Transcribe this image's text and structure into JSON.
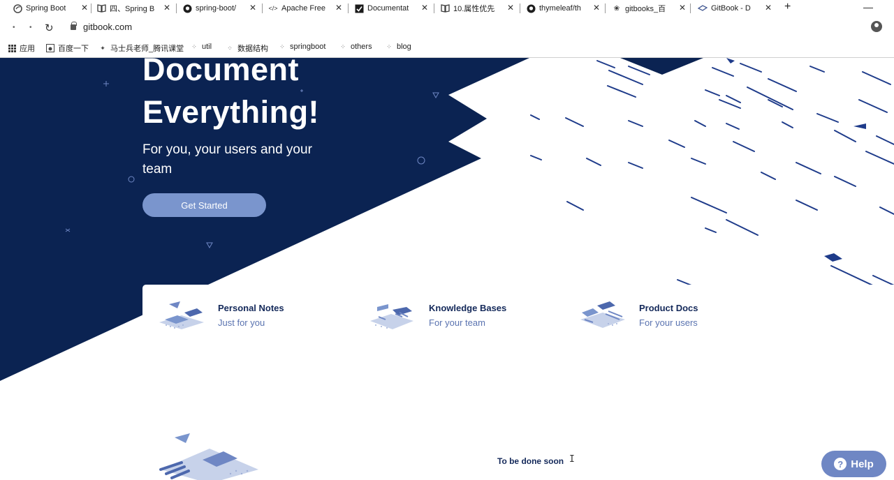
{
  "browser": {
    "tabs": [
      {
        "title": "Spring Boot",
        "icon": "spring-icon"
      },
      {
        "title": "四、Spring B",
        "icon": "book-icon"
      },
      {
        "title": "spring-boot/",
        "icon": "github-icon"
      },
      {
        "title": "Apache Free",
        "icon": "code-icon"
      },
      {
        "title": "Documentat",
        "icon": "doc-icon"
      },
      {
        "title": "10.属性优先",
        "icon": "book-icon"
      },
      {
        "title": "thymeleaf/th",
        "icon": "github-icon"
      },
      {
        "title": "gitbooks_百",
        "icon": "paw-icon"
      },
      {
        "title": "GitBook - D",
        "icon": "gitbook-icon"
      }
    ],
    "url": "gitbook.com",
    "bookmarks": [
      {
        "label": "应用",
        "icon": "apps-grid-icon"
      },
      {
        "label": "百度一下",
        "icon": "baidu-icon"
      },
      {
        "label": "马士兵老师_腾讯课堂",
        "icon": "bookmark-icon"
      },
      {
        "label": "util",
        "icon": "folder-icon"
      },
      {
        "label": "数据结构",
        "icon": "folder-icon"
      },
      {
        "label": "springboot",
        "icon": "folder-icon"
      },
      {
        "label": "others",
        "icon": "folder-icon"
      },
      {
        "label": "blog",
        "icon": "folder-icon"
      }
    ]
  },
  "hero": {
    "title_line1": "Document",
    "title_line2": "Everything!",
    "subtitle": "For you, your users and your team",
    "cta": "Get Started"
  },
  "features": [
    {
      "title": "Personal Notes",
      "subtitle": "Just for you"
    },
    {
      "title": "Knowledge Bases",
      "subtitle": "For your team"
    },
    {
      "title": "Product Docs",
      "subtitle": "For your users"
    }
  ],
  "bottom": {
    "status": "To be done soon"
  },
  "help": {
    "label": "Help"
  },
  "colors": {
    "navy": "#0b2352",
    "accent": "#7a95cd",
    "help": "#6f87c4"
  }
}
